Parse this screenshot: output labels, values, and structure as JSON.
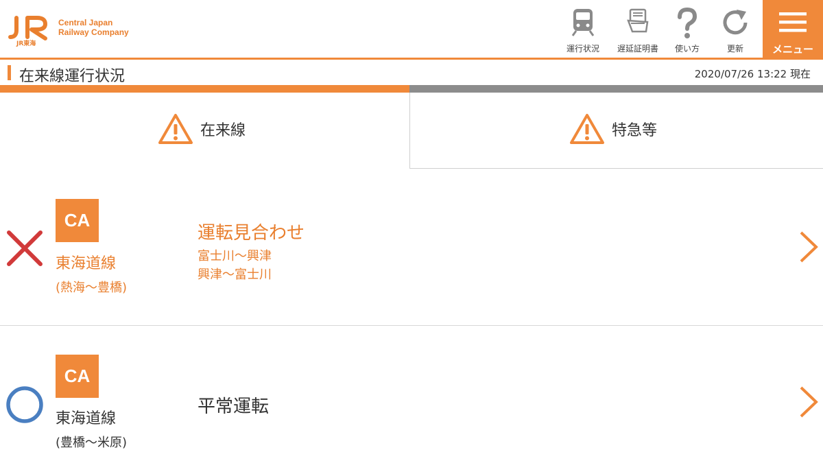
{
  "header": {
    "logo_mark": "JR",
    "logo_sub": "JR東海",
    "company_line1": "Central Japan",
    "company_line2": "Railway Company",
    "tools": [
      {
        "label": "運行状況",
        "icon": "train-icon"
      },
      {
        "label": "遅延証明書",
        "icon": "certificate-icon"
      },
      {
        "label": "使い方",
        "icon": "help-icon"
      },
      {
        "label": "更新",
        "icon": "refresh-icon"
      }
    ],
    "menu_label": "メニュー"
  },
  "page": {
    "title": "在来線運行状況",
    "timestamp": "2020/07/26 13:22 現在"
  },
  "tabs": [
    {
      "label": "在来線",
      "icon": "warning-icon",
      "active": true
    },
    {
      "label": "特急等",
      "icon": "warning-icon",
      "active": false
    }
  ],
  "lines": [
    {
      "status_icon": "cross-icon",
      "badge": "CA",
      "name": "東海道線",
      "range": "(熱海〜豊橋)",
      "status": "運転見合わせ",
      "sections": [
        "富士川〜興津",
        "興津〜富士川"
      ]
    },
    {
      "status_icon": "circle-icon",
      "badge": "CA",
      "name": "東海道線",
      "range": "(豊橋〜米原)",
      "status": "平常運転",
      "sections": []
    }
  ],
  "colors": {
    "accent": "#f0893a",
    "alert_red": "#d13a3a",
    "normal_blue": "#4a7fc1",
    "tab_inactive": "#8c8c8c"
  }
}
